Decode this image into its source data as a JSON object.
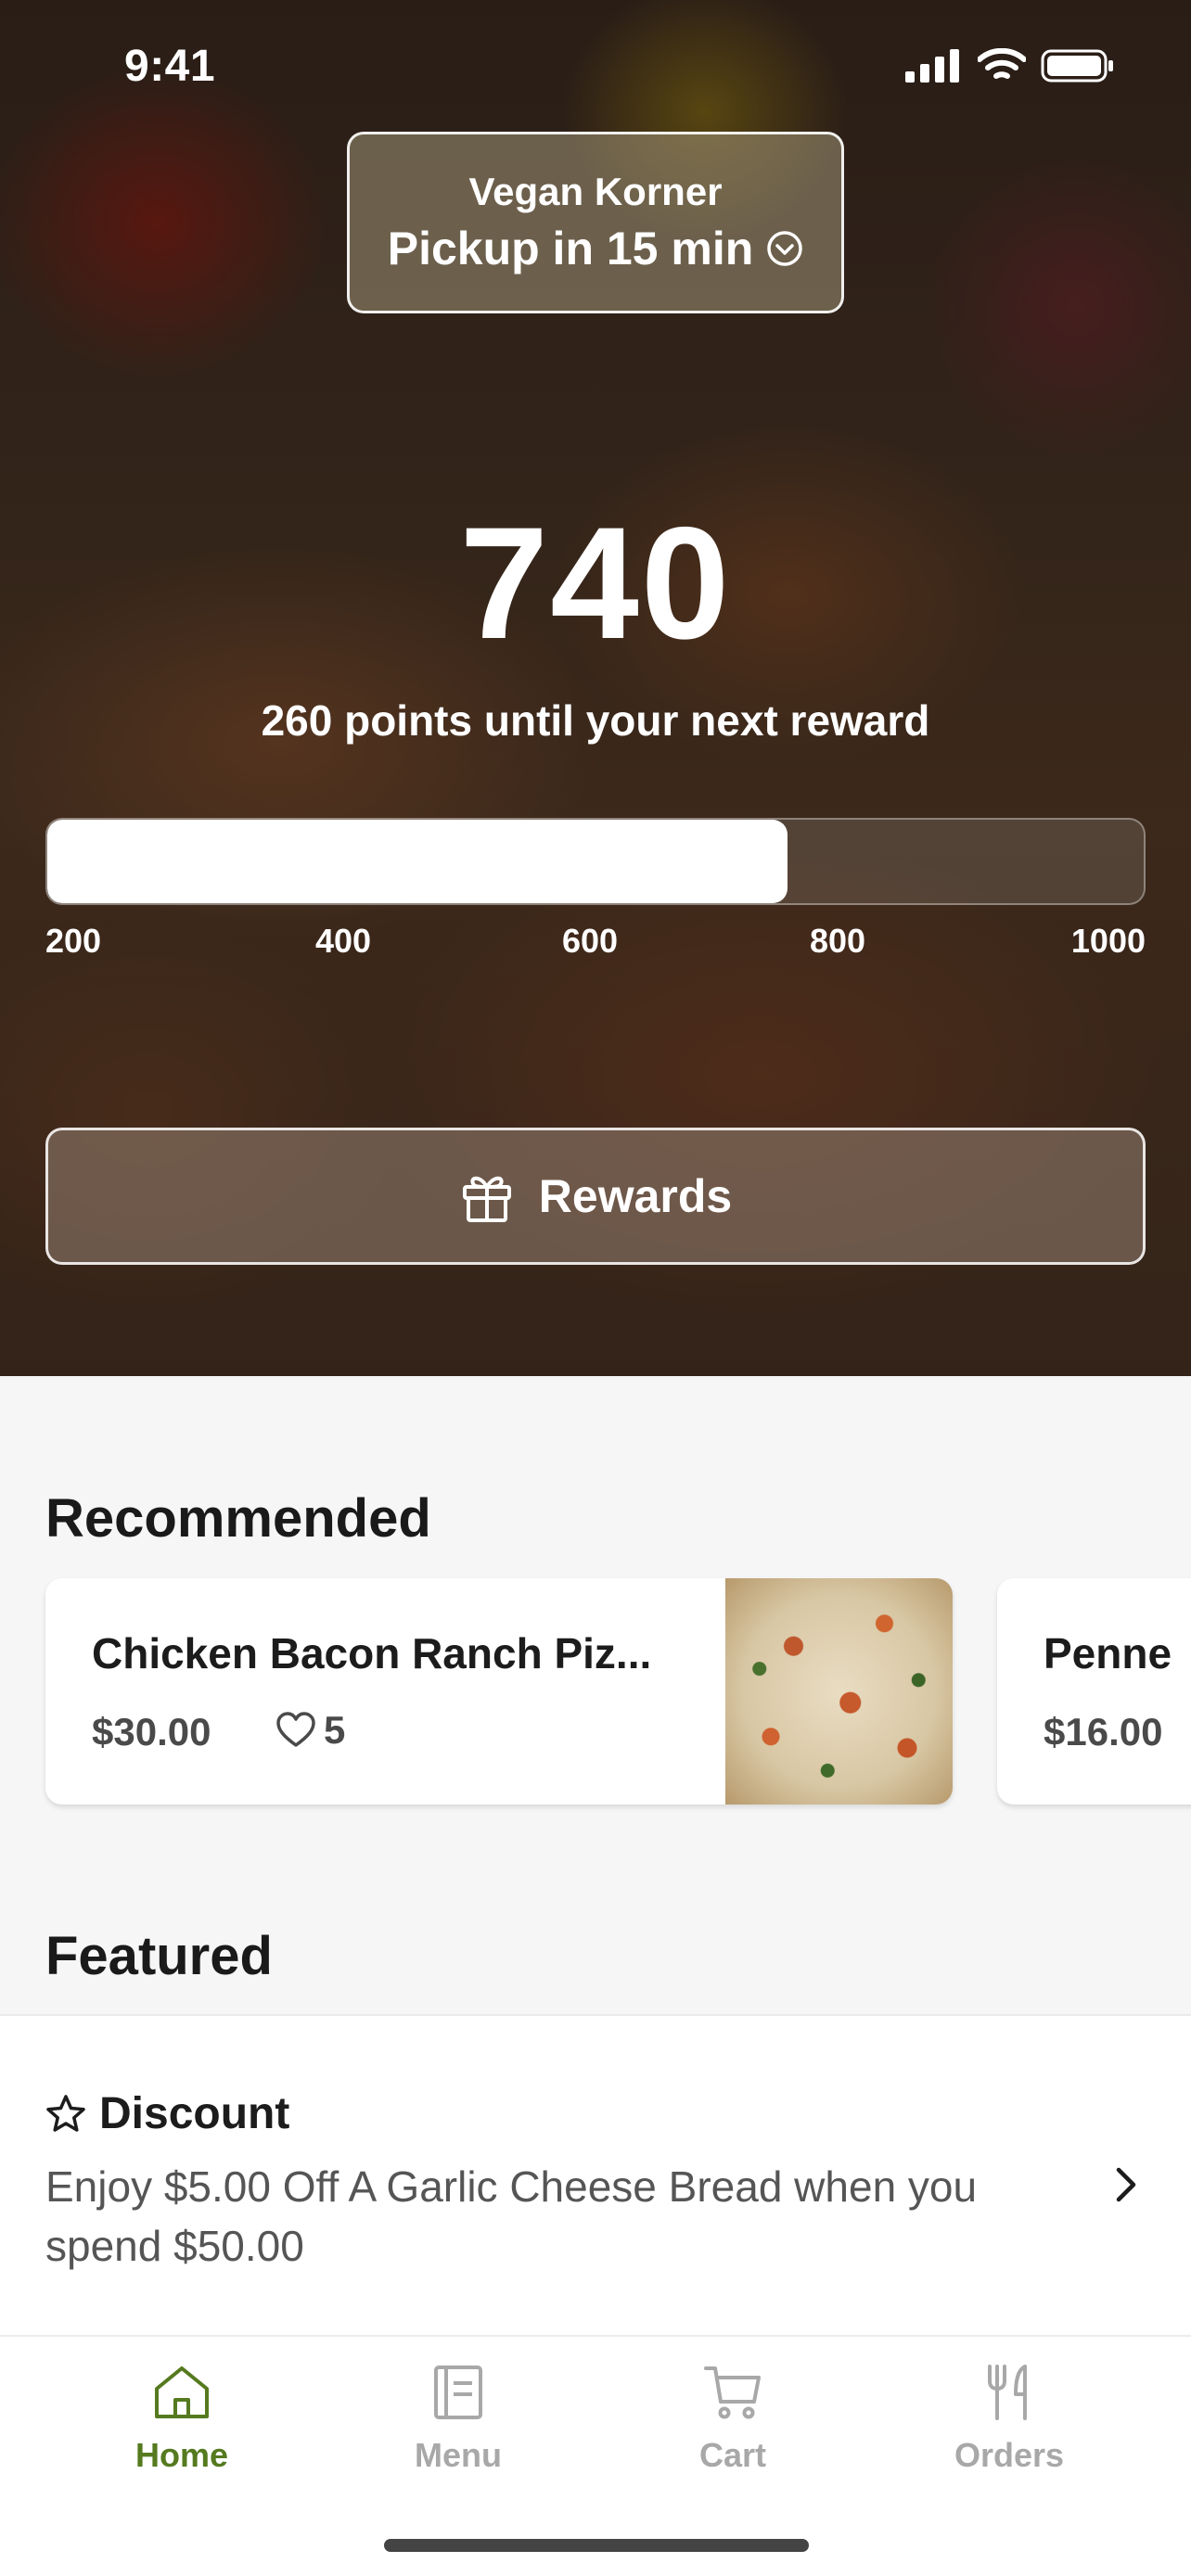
{
  "status_bar": {
    "time": "9:41"
  },
  "store": {
    "name": "Vegan Korner",
    "pickup": "Pickup in 15 min"
  },
  "points": {
    "value": "740",
    "caption": "260 points until your next reward",
    "progress_fraction": 0.675,
    "ticks": [
      "200",
      "400",
      "600",
      "800",
      "1000"
    ]
  },
  "rewards_button": {
    "label": "Rewards",
    "icon": "gift-icon"
  },
  "recommended": {
    "title": "Recommended",
    "items": [
      {
        "name": "Chicken Bacon Ranch Piz...",
        "price": "$30.00",
        "likes": "5"
      },
      {
        "name": "Penne",
        "price": "$16.00"
      }
    ]
  },
  "featured": {
    "title": "Featured",
    "item": {
      "heading": "Discount",
      "description": "Enjoy $5.00 Off A Garlic Cheese Bread when you spend $50.00"
    }
  },
  "tabs": [
    {
      "label": "Home",
      "icon": "home-icon",
      "active": true
    },
    {
      "label": "Menu",
      "icon": "menu-icon",
      "active": false
    },
    {
      "label": "Cart",
      "icon": "cart-icon",
      "active": false
    },
    {
      "label": "Orders",
      "icon": "utensils-icon",
      "active": false
    }
  ],
  "colors": {
    "accent": "#557a1f",
    "inactive": "#a8a8a8"
  }
}
